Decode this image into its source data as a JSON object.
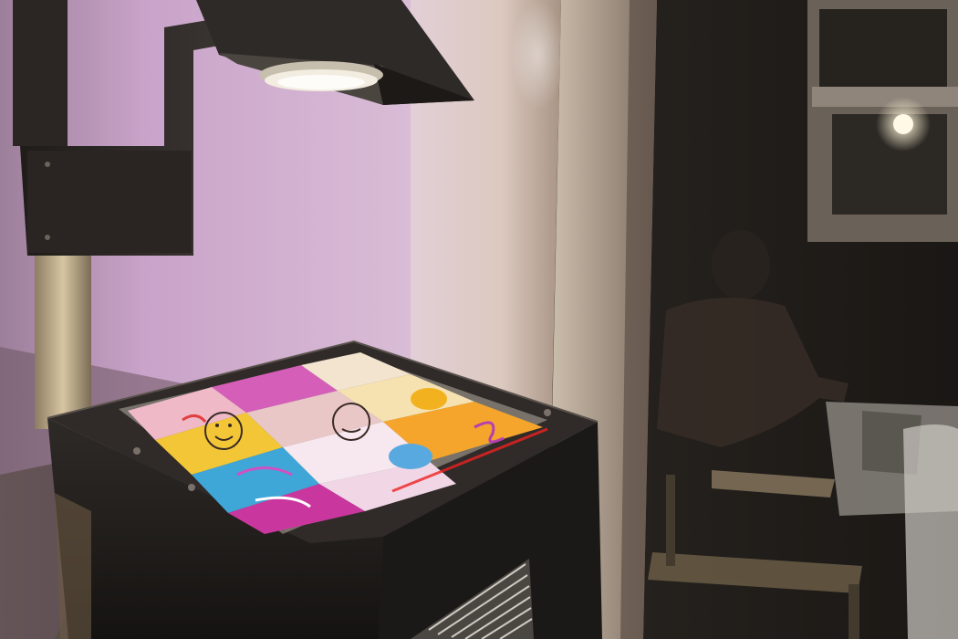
{
  "photo": {
    "alt": "",
    "colors": {
      "wall_pink": "#c9a3c9",
      "wall_cream": "#e6d8cc",
      "projector_body": "#24211f",
      "dark_room": "#1a1714",
      "tile_yellow": "#f2c636",
      "tile_magenta": "#c9379e",
      "tile_cyan": "#3fa6d8"
    },
    "icons": [
      "overhead-projector",
      "projector-arm",
      "projector-lens",
      "transparency-tiles",
      "window",
      "ceiling-light",
      "seated-person"
    ]
  }
}
